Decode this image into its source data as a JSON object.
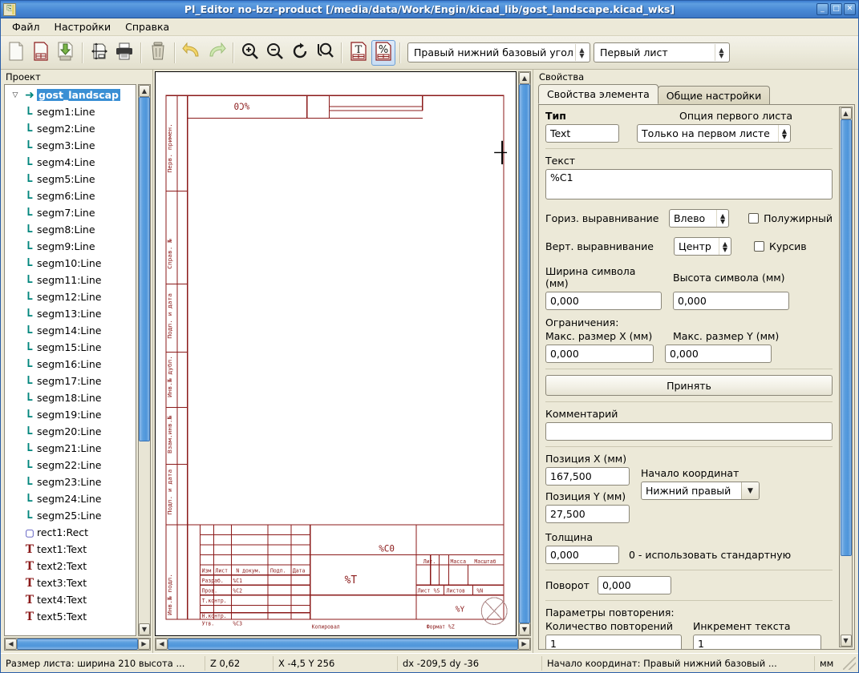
{
  "window": {
    "title": "Pl_Editor no-bzr-product [/media/data/Work/Engin/kicad_lib/gost_landscape.kicad_wks]",
    "minimize": "_",
    "maximize": "□",
    "close": "✕"
  },
  "menubar": {
    "items": [
      {
        "label": "Файл"
      },
      {
        "label": "Настройки"
      },
      {
        "label": "Справка"
      }
    ]
  },
  "toolbar": {
    "buttons": [
      {
        "name": "new-page-layout",
        "icon": "new-page-icon"
      },
      {
        "name": "open-page-layout",
        "icon": "open-page-icon"
      },
      {
        "name": "save-page-layout",
        "icon": "save-icon"
      },
      {
        "name": "page-settings",
        "icon": "page-settings-icon"
      },
      {
        "name": "print",
        "icon": "printer-icon"
      },
      {
        "name": "delete",
        "icon": "trash-icon"
      },
      {
        "name": "undo",
        "icon": "undo-arrow-icon"
      },
      {
        "name": "redo",
        "icon": "redo-arrow-icon"
      },
      {
        "name": "zoom-in",
        "icon": "zoom-in-icon"
      },
      {
        "name": "zoom-out",
        "icon": "zoom-out-icon"
      },
      {
        "name": "redraw",
        "icon": "refresh-icon"
      },
      {
        "name": "zoom-fit",
        "icon": "zoom-fit-icon"
      },
      {
        "name": "show-text",
        "icon": "text-page-icon"
      },
      {
        "name": "show-placeholders",
        "icon": "percent-page-icon",
        "active": true
      }
    ],
    "origin_combo": {
      "value": "Правый нижний базовый угол"
    },
    "sheet_combo": {
      "value": "Первый лист"
    }
  },
  "tree": {
    "header": "Проект",
    "root": {
      "label": "gost_landscap",
      "icon": "arrow-icon",
      "selected": true
    },
    "items": [
      {
        "label": "segm1:Line",
        "icon": "line-icon"
      },
      {
        "label": "segm2:Line",
        "icon": "line-icon"
      },
      {
        "label": "segm3:Line",
        "icon": "line-icon"
      },
      {
        "label": "segm4:Line",
        "icon": "line-icon"
      },
      {
        "label": "segm5:Line",
        "icon": "line-icon"
      },
      {
        "label": "segm6:Line",
        "icon": "line-icon"
      },
      {
        "label": "segm7:Line",
        "icon": "line-icon"
      },
      {
        "label": "segm8:Line",
        "icon": "line-icon"
      },
      {
        "label": "segm9:Line",
        "icon": "line-icon"
      },
      {
        "label": "segm10:Line",
        "icon": "line-icon"
      },
      {
        "label": "segm11:Line",
        "icon": "line-icon"
      },
      {
        "label": "segm12:Line",
        "icon": "line-icon"
      },
      {
        "label": "segm13:Line",
        "icon": "line-icon"
      },
      {
        "label": "segm14:Line",
        "icon": "line-icon"
      },
      {
        "label": "segm15:Line",
        "icon": "line-icon"
      },
      {
        "label": "segm16:Line",
        "icon": "line-icon"
      },
      {
        "label": "segm17:Line",
        "icon": "line-icon"
      },
      {
        "label": "segm18:Line",
        "icon": "line-icon"
      },
      {
        "label": "segm19:Line",
        "icon": "line-icon"
      },
      {
        "label": "segm20:Line",
        "icon": "line-icon"
      },
      {
        "label": "segm21:Line",
        "icon": "line-icon"
      },
      {
        "label": "segm22:Line",
        "icon": "line-icon"
      },
      {
        "label": "segm23:Line",
        "icon": "line-icon"
      },
      {
        "label": "segm24:Line",
        "icon": "line-icon"
      },
      {
        "label": "segm25:Line",
        "icon": "line-icon"
      },
      {
        "label": "rect1:Rect",
        "icon": "rect-icon"
      },
      {
        "label": "text1:Text",
        "icon": "text-icon"
      },
      {
        "label": "text2:Text",
        "icon": "text-icon"
      },
      {
        "label": "text3:Text",
        "icon": "text-icon"
      },
      {
        "label": "text4:Text",
        "icon": "text-icon"
      },
      {
        "label": "text5:Text",
        "icon": "text-icon"
      }
    ]
  },
  "canvas": {
    "title_block": {
      "top_placeholder": "%C0",
      "side_labels": [
        "Перв. примен.",
        "Справ. №",
        "Подп. и дата",
        "Инв.№ дубл.",
        "Взам.инв.№",
        "Подп. и дата",
        "Инв.№ подл."
      ],
      "col_headers": [
        "Изм",
        "Лист",
        "N докум.",
        "Подп.",
        "Дата"
      ],
      "role_rows": [
        "Разраб.",
        "Пров.",
        "Т.контр.",
        "",
        "Н.контр.",
        "Утв."
      ],
      "role_values": [
        "%C1",
        "%C2",
        "",
        "",
        "",
        "%C3"
      ],
      "center_name": "%C0",
      "designation": "%T",
      "right_headers": [
        "Лит.",
        "Масса",
        "Масштаб"
      ],
      "sheet_row": [
        "Лист",
        "%S",
        "Листов",
        "%N"
      ],
      "company": "%Y",
      "footer_left": "Копировал",
      "footer_right": "Формат %Z"
    }
  },
  "properties": {
    "header": "Свойства",
    "tabs": [
      {
        "label": "Свойства элемента",
        "active": true
      },
      {
        "label": "Общие настройки",
        "active": false
      }
    ],
    "type_label": "Тип",
    "type_value": "Text",
    "first_page_option_label": "Опция первого листа",
    "first_page_option_value": "Только на первом листе",
    "text_label": "Текст",
    "text_value": "%C1",
    "hjustify_label": "Гориз. выравнивание",
    "hjustify_value": "Влево",
    "bold_label": "Полужирный",
    "bold_checked": false,
    "vjustify_label": "Верт. выравнивание",
    "vjustify_value": "Центр",
    "italic_label": "Курсив",
    "italic_checked": false,
    "char_width_label": "Ширина символа (мм)",
    "char_width_value": "0,000",
    "char_height_label": "Высота символа (мм)",
    "char_height_value": "0,000",
    "constraints_label": "Ограничения:",
    "max_x_label": "Макс. размер X (мм)",
    "max_x_value": "0,000",
    "max_y_label": "Макс. размер Y (мм)",
    "max_y_value": "0,000",
    "apply_button": "Принять",
    "comment_label": "Комментарий",
    "comment_value": "",
    "pos_x_label": "Позиция X (мм)",
    "pos_x_value": "167,500",
    "pos_y_label": "Позиция Y (мм)",
    "pos_y_value": "27,500",
    "origin_label": "Начало координат",
    "origin_value": "Нижний правый",
    "thickness_label": "Толщина",
    "thickness_value": "0,000",
    "thickness_hint": "0 - использовать стандартную",
    "rotation_label": "Поворот",
    "rotation_value": "0,000",
    "repeat_label": "Параметры повторения:",
    "repeat_count_label": "Количество повторений",
    "repeat_count_value": "1",
    "text_increment_label": "Инкремент текста",
    "text_increment_value": "1"
  },
  "statusbar": {
    "sheet_size": "Размер листа: ширина 210 высота ...",
    "zoom": "Z 0,62",
    "coords": "X -4,5  Y 256",
    "delta": "dx -209,5  dy -36",
    "origin": "Начало координат: Правый нижний базовый ...",
    "units": "мм"
  },
  "colors": {
    "title_bar": "#4a8ad6",
    "selection": "#3a8fd4",
    "drawing": "#8b1a1a",
    "tree_icon_teal": "#00867d",
    "accent_blue": "#5a9ede"
  }
}
